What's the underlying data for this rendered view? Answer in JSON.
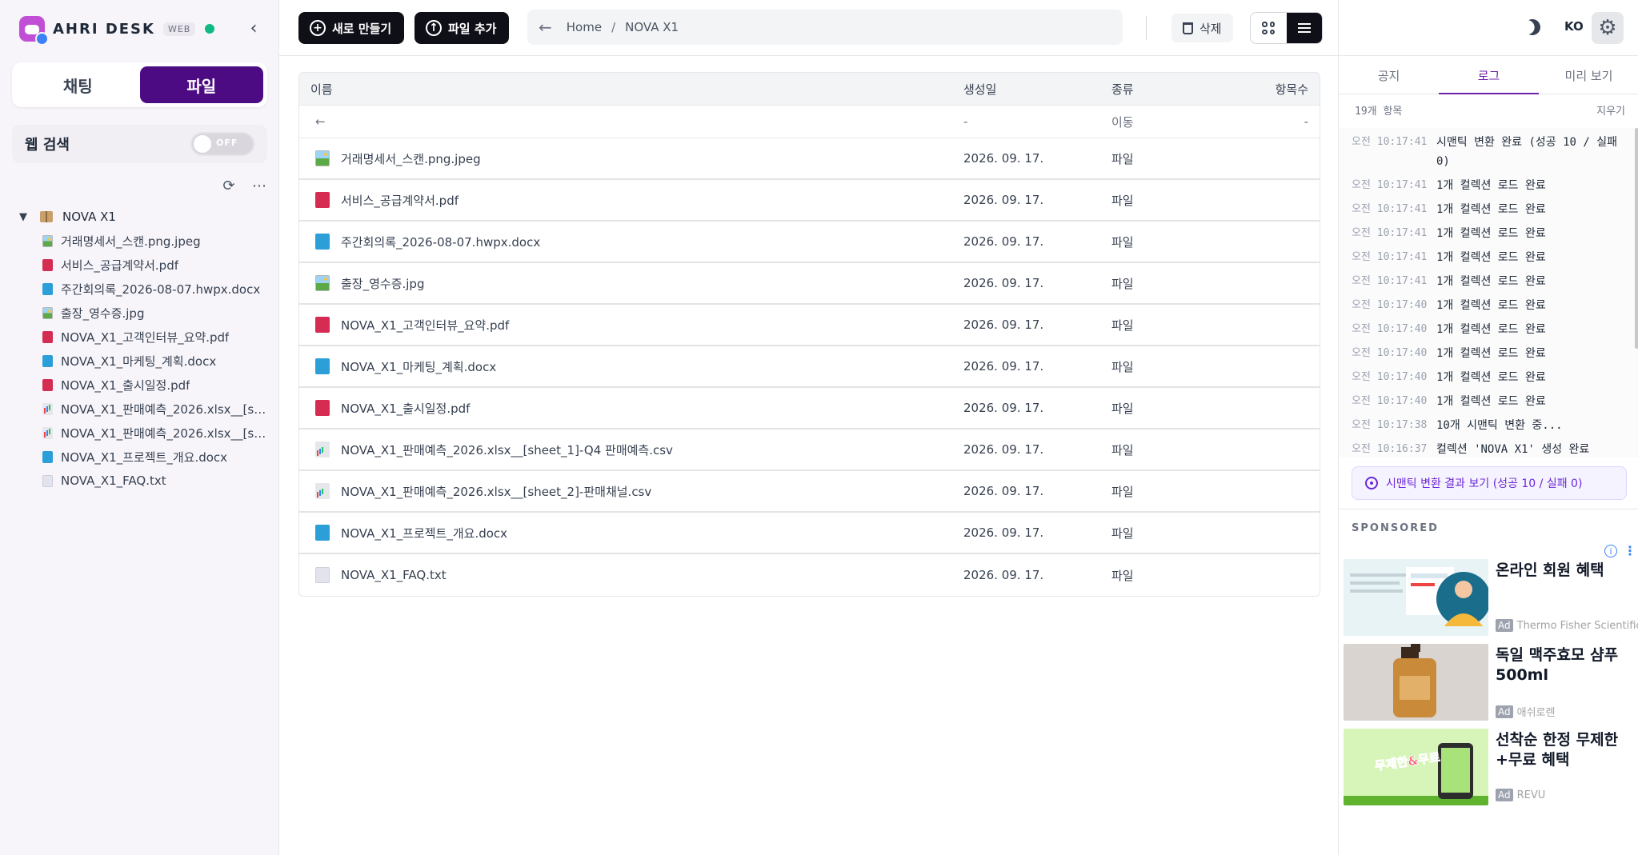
{
  "app": {
    "name": "AHRI DESK",
    "badge": "WEB"
  },
  "sidebar": {
    "tabs": [
      {
        "label": "채팅"
      },
      {
        "label": "파일"
      }
    ],
    "web_search": {
      "label": "웹 검색",
      "toggle": "OFF",
      "enabled": false
    },
    "tree": {
      "root": "NOVA X1",
      "items": [
        {
          "label": "거래명세서_스캔.png.jpeg",
          "icon": "image-file-icon"
        },
        {
          "label": "서비스_공급계약서.pdf",
          "icon": "pdf-file-icon"
        },
        {
          "label": "주간회의록_2026-08-07.hwpx.docx",
          "icon": "doc-file-icon"
        },
        {
          "label": "출장_영수증.jpg",
          "icon": "image-file-icon"
        },
        {
          "label": "NOVA_X1_고객인터뷰_요약.pdf",
          "icon": "pdf-file-icon"
        },
        {
          "label": "NOVA_X1_마케팅_계획.docx",
          "icon": "doc-file-icon"
        },
        {
          "label": "NOVA_X1_출시일정.pdf",
          "icon": "pdf-file-icon"
        },
        {
          "label": "NOVA_X1_판매예측_2026.xlsx__[sh...",
          "icon": "sheet-file-icon"
        },
        {
          "label": "NOVA_X1_판매예측_2026.xlsx__[sh...",
          "icon": "sheet-file-icon"
        },
        {
          "label": "NOVA_X1_프로젝트_개요.docx",
          "icon": "doc-file-icon"
        },
        {
          "label": "NOVA_X1_FAQ.txt",
          "icon": "text-file-icon"
        }
      ]
    }
  },
  "toolbar": {
    "new_label": "새로 만들기",
    "add_file_label": "파일 추가",
    "breadcrumb": {
      "home": "Home",
      "separator": "/",
      "current": "NOVA X1"
    },
    "delete_label": "삭제"
  },
  "table": {
    "columns": {
      "name": "이름",
      "created": "생성일",
      "type": "종류",
      "count": "항목수"
    },
    "back_row": {
      "date": "-",
      "type": "이동",
      "count": "-"
    },
    "rows": [
      {
        "name": "거래명세서_스캔.png.jpeg",
        "date": "2026. 09. 17.",
        "type": "파일",
        "icon": "image-file-icon"
      },
      {
        "name": "서비스_공급계약서.pdf",
        "date": "2026. 09. 17.",
        "type": "파일",
        "icon": "pdf-file-icon"
      },
      {
        "name": "주간회의록_2026-08-07.hwpx.docx",
        "date": "2026. 09. 17.",
        "type": "파일",
        "icon": "doc-file-icon"
      },
      {
        "name": "출장_영수증.jpg",
        "date": "2026. 09. 17.",
        "type": "파일",
        "icon": "image-file-icon"
      },
      {
        "name": "NOVA_X1_고객인터뷰_요약.pdf",
        "date": "2026. 09. 17.",
        "type": "파일",
        "icon": "pdf-file-icon"
      },
      {
        "name": "NOVA_X1_마케팅_계획.docx",
        "date": "2026. 09. 17.",
        "type": "파일",
        "icon": "doc-file-icon"
      },
      {
        "name": "NOVA_X1_출시일정.pdf",
        "date": "2026. 09. 17.",
        "type": "파일",
        "icon": "pdf-file-icon"
      },
      {
        "name": "NOVA_X1_판매예측_2026.xlsx__[sheet_1]-Q4 판매예측.csv",
        "date": "2026. 09. 17.",
        "type": "파일",
        "icon": "sheet-file-icon"
      },
      {
        "name": "NOVA_X1_판매예측_2026.xlsx__[sheet_2]-판매채널.csv",
        "date": "2026. 09. 17.",
        "type": "파일",
        "icon": "sheet-file-icon"
      },
      {
        "name": "NOVA_X1_프로젝트_개요.docx",
        "date": "2026. 09. 17.",
        "type": "파일",
        "icon": "doc-file-icon"
      },
      {
        "name": "NOVA_X1_FAQ.txt",
        "date": "2026. 09. 17.",
        "type": "파일",
        "icon": "text-file-icon"
      }
    ]
  },
  "right_panel": {
    "lang": "KO",
    "tabs": [
      {
        "label": "공지"
      },
      {
        "label": "로그"
      },
      {
        "label": "미리 보기"
      }
    ],
    "log": {
      "count_label": "19개 항목",
      "clear_label": "지우기",
      "entries": [
        {
          "ampm": "오전",
          "time": "10:17:41",
          "msg": "시맨틱 변환 완료 (성공 10 / 실패 0)"
        },
        {
          "ampm": "오전",
          "time": "10:17:41",
          "msg": "1개 컬렉션 로드 완료"
        },
        {
          "ampm": "오전",
          "time": "10:17:41",
          "msg": "1개 컬렉션 로드 완료"
        },
        {
          "ampm": "오전",
          "time": "10:17:41",
          "msg": "1개 컬렉션 로드 완료"
        },
        {
          "ampm": "오전",
          "time": "10:17:41",
          "msg": "1개 컬렉션 로드 완료"
        },
        {
          "ampm": "오전",
          "time": "10:17:41",
          "msg": "1개 컬렉션 로드 완료"
        },
        {
          "ampm": "오전",
          "time": "10:17:40",
          "msg": "1개 컬렉션 로드 완료"
        },
        {
          "ampm": "오전",
          "time": "10:17:40",
          "msg": "1개 컬렉션 로드 완료"
        },
        {
          "ampm": "오전",
          "time": "10:17:40",
          "msg": "1개 컬렉션 로드 완료"
        },
        {
          "ampm": "오전",
          "time": "10:17:40",
          "msg": "1개 컬렉션 로드 완료"
        },
        {
          "ampm": "오전",
          "time": "10:17:40",
          "msg": "1개 컬렉션 로드 완료"
        },
        {
          "ampm": "오전",
          "time": "10:17:38",
          "msg": "10개 시맨틱 변환 중..."
        },
        {
          "ampm": "오전",
          "time": "10:16:37",
          "msg": "컬렉션 'NOVA X1' 생성 완료"
        }
      ]
    },
    "result_button": "시맨틱 변환 결과 보기 (성공 10 / 실패 0)",
    "sponsored": {
      "label": "SPONSORED",
      "ads": [
        {
          "title": "온라인 회원 혜택",
          "tag": "Ad",
          "source": "Thermo Fisher Scientific"
        },
        {
          "title": "독일 맥주효모 샴푸 500ml",
          "tag": "Ad",
          "source": "애쉬로렌"
        },
        {
          "title": "선착순 한정 무제한+무료 혜택",
          "tag": "Ad",
          "source": "REVU",
          "image_text": "무제한&무료"
        }
      ]
    }
  },
  "colors": {
    "accent": "#4c0b83",
    "dark_button": "#0f0f17",
    "status_online": "#10b981",
    "tab_active": "#6b21a8"
  }
}
